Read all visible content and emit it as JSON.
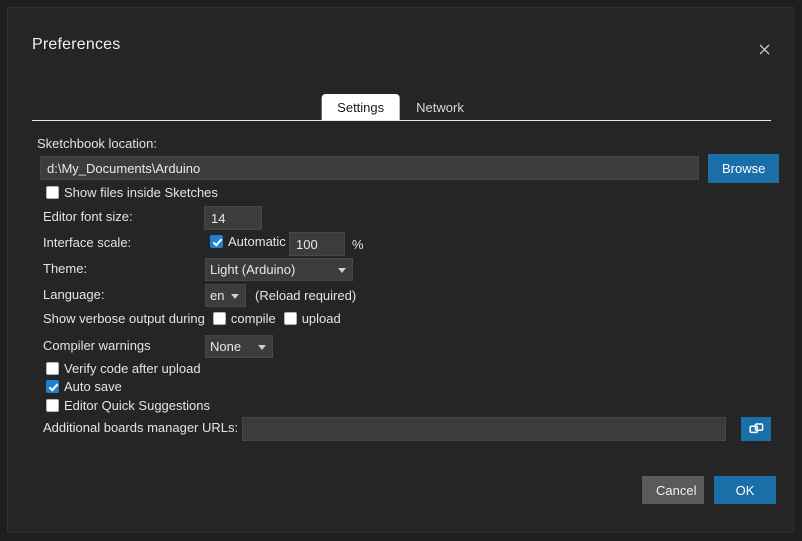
{
  "dialog": {
    "title": "Preferences",
    "close_icon": "close-icon"
  },
  "tabs": [
    {
      "label": "Settings",
      "active": true
    },
    {
      "label": "Network",
      "active": false
    }
  ],
  "settings": {
    "sketchbook_label": "Sketchbook location:",
    "sketchbook_value": "d:\\My_Documents\\Arduino",
    "sketchbook_placeholder": "",
    "browse_label": "Browse",
    "show_files_label": "Show files inside Sketches",
    "show_files_checked": false,
    "editor_font_label": "Editor font size:",
    "editor_font_value": "14",
    "interface_scale_label": "Interface scale:",
    "automatic_label": "Automatic",
    "automatic_checked": true,
    "scale_value": "100",
    "percent_sign": "%",
    "theme_label": "Theme:",
    "theme_value": "Light (Arduino)",
    "theme_options": [
      "Light (Arduino)"
    ],
    "language_label": "Language:",
    "language_value": "en",
    "language_options": [
      "en"
    ],
    "reload_note": "(Reload required)",
    "verbose_label": "Show verbose output during",
    "verbose_compile_label": "compile",
    "verbose_compile_checked": false,
    "verbose_upload_label": "upload",
    "verbose_upload_checked": false,
    "compiler_warnings_label": "Compiler warnings",
    "compiler_warnings_value": "None",
    "compiler_warnings_options": [
      "None"
    ],
    "verify_label": "Verify code after upload",
    "verify_checked": false,
    "autosave_label": "Auto save",
    "autosave_checked": true,
    "quick_suggestions_label": "Editor Quick Suggestions",
    "quick_suggestions_checked": false,
    "boards_urls_label": "Additional boards manager URLs:",
    "boards_urls_value": "",
    "boards_urls_placeholder": "",
    "boards_urls_edit_icon": "open-window-icon"
  },
  "footer": {
    "cancel_label": "Cancel",
    "ok_label": "OK"
  },
  "colors": {
    "accent": "#1a6fa8",
    "checkbox_checked": "#1f7fd0",
    "dialog_bg": "#252526",
    "field_bg": "#3c3c3c"
  }
}
